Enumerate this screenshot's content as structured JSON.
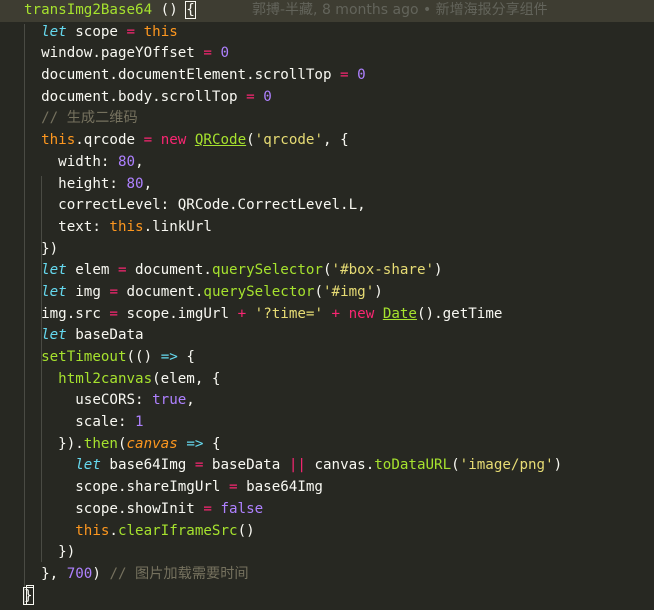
{
  "blame_annotation": "郭搏-半藏, 8 months ago • 新增海报分享组件",
  "lines": [
    [
      [
        "fn",
        "transImg2Base64"
      ],
      [
        "plain",
        " () "
      ],
      [
        "bracket",
        "{"
      ]
    ],
    [
      [
        "plain",
        "  "
      ],
      [
        "kw",
        "let"
      ],
      [
        "plain",
        " scope "
      ],
      [
        "op",
        "="
      ],
      [
        "plain",
        " "
      ],
      [
        "this",
        "this"
      ]
    ],
    [
      [
        "plain",
        "  window.pageYOffset "
      ],
      [
        "op",
        "="
      ],
      [
        "plain",
        " "
      ],
      [
        "num",
        "0"
      ]
    ],
    [
      [
        "plain",
        "  document.documentElement.scrollTop "
      ],
      [
        "op",
        "="
      ],
      [
        "plain",
        " "
      ],
      [
        "num",
        "0"
      ]
    ],
    [
      [
        "plain",
        "  document.body.scrollTop "
      ],
      [
        "op",
        "="
      ],
      [
        "plain",
        " "
      ],
      [
        "num",
        "0"
      ]
    ],
    [
      [
        "plain",
        "  "
      ],
      [
        "cmt",
        "// 生成二维码"
      ]
    ],
    [
      [
        "plain",
        "  "
      ],
      [
        "this",
        "this"
      ],
      [
        "plain",
        ".qrcode "
      ],
      [
        "op",
        "="
      ],
      [
        "plain",
        " "
      ],
      [
        "op",
        "new"
      ],
      [
        "plain",
        " "
      ],
      [
        "cls",
        "QRCode"
      ],
      [
        "plain",
        "("
      ],
      [
        "str",
        "'qrcode'"
      ],
      [
        "plain",
        ", {"
      ]
    ],
    [
      [
        "plain",
        "    width: "
      ],
      [
        "num",
        "80"
      ],
      [
        "plain",
        ","
      ]
    ],
    [
      [
        "plain",
        "    height: "
      ],
      [
        "num",
        "80"
      ],
      [
        "plain",
        ","
      ]
    ],
    [
      [
        "plain",
        "    correctLevel: QRCode.CorrectLevel.L,"
      ]
    ],
    [
      [
        "plain",
        "    text: "
      ],
      [
        "this",
        "this"
      ],
      [
        "plain",
        ".linkUrl"
      ]
    ],
    [
      [
        "plain",
        "  })"
      ]
    ],
    [
      [
        "plain",
        "  "
      ],
      [
        "kw",
        "let"
      ],
      [
        "plain",
        " elem "
      ],
      [
        "op",
        "="
      ],
      [
        "plain",
        " document."
      ],
      [
        "fn",
        "querySelector"
      ],
      [
        "plain",
        "("
      ],
      [
        "str",
        "'#box-share'"
      ],
      [
        "plain",
        ")"
      ]
    ],
    [
      [
        "plain",
        "  "
      ],
      [
        "kw",
        "let"
      ],
      [
        "plain",
        " img "
      ],
      [
        "op",
        "="
      ],
      [
        "plain",
        " document."
      ],
      [
        "fn",
        "querySelector"
      ],
      [
        "plain",
        "("
      ],
      [
        "str",
        "'#img'"
      ],
      [
        "plain",
        ")"
      ]
    ],
    [
      [
        "plain",
        "  img.src "
      ],
      [
        "op",
        "="
      ],
      [
        "plain",
        " scope.imgUrl "
      ],
      [
        "op",
        "+"
      ],
      [
        "plain",
        " "
      ],
      [
        "str",
        "'?time='"
      ],
      [
        "plain",
        " "
      ],
      [
        "op",
        "+"
      ],
      [
        "plain",
        " "
      ],
      [
        "op",
        "new"
      ],
      [
        "plain",
        " "
      ],
      [
        "cls",
        "Date"
      ],
      [
        "plain",
        "().getTime"
      ]
    ],
    [
      [
        "plain",
        "  "
      ],
      [
        "kw",
        "let"
      ],
      [
        "plain",
        " baseData"
      ]
    ],
    [
      [
        "plain",
        "  "
      ],
      [
        "fn2",
        "setTimeout"
      ],
      [
        "plain",
        "(() "
      ],
      [
        "kw2",
        "=>"
      ],
      [
        "plain",
        " {"
      ]
    ],
    [
      [
        "plain",
        "    "
      ],
      [
        "fn",
        "html2canvas"
      ],
      [
        "plain",
        "(elem, {"
      ]
    ],
    [
      [
        "plain",
        "      useCORS: "
      ],
      [
        "const",
        "true"
      ],
      [
        "plain",
        ","
      ]
    ],
    [
      [
        "plain",
        "      scale: "
      ],
      [
        "num",
        "1"
      ]
    ],
    [
      [
        "plain",
        "    })."
      ],
      [
        "fn",
        "then"
      ],
      [
        "plain",
        "("
      ],
      [
        "param",
        "canvas"
      ],
      [
        "plain",
        " "
      ],
      [
        "kw2",
        "=>"
      ],
      [
        "plain",
        " {"
      ]
    ],
    [
      [
        "plain",
        "      "
      ],
      [
        "kw",
        "let"
      ],
      [
        "plain",
        " base64Img "
      ],
      [
        "op",
        "="
      ],
      [
        "plain",
        " baseData "
      ],
      [
        "op",
        "||"
      ],
      [
        "plain",
        " canvas."
      ],
      [
        "fn",
        "toDataURL"
      ],
      [
        "plain",
        "("
      ],
      [
        "str",
        "'image/png'"
      ],
      [
        "plain",
        ")"
      ]
    ],
    [
      [
        "plain",
        "      scope.shareImgUrl "
      ],
      [
        "op",
        "="
      ],
      [
        "plain",
        " base64Img"
      ]
    ],
    [
      [
        "plain",
        "      scope.showInit "
      ],
      [
        "op",
        "="
      ],
      [
        "plain",
        " "
      ],
      [
        "const",
        "false"
      ]
    ],
    [
      [
        "plain",
        "      "
      ],
      [
        "this",
        "this"
      ],
      [
        "plain",
        "."
      ],
      [
        "fn",
        "clearIframeSrc"
      ],
      [
        "plain",
        "()"
      ]
    ],
    [
      [
        "plain",
        "    })"
      ]
    ],
    [
      [
        "plain",
        "  }, "
      ],
      [
        "num",
        "700"
      ],
      [
        "plain",
        ") "
      ],
      [
        "cmt",
        "// 图片加载需要时间"
      ]
    ],
    [
      [
        "bracket",
        "}"
      ]
    ]
  ]
}
